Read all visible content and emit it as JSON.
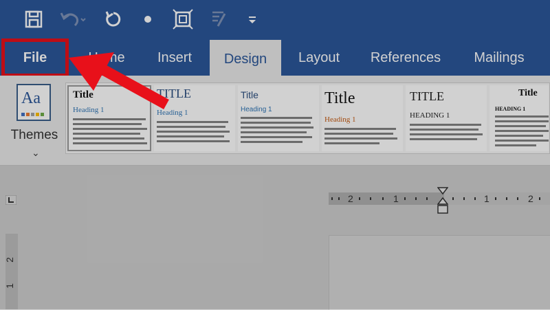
{
  "colors": {
    "ribbon_blue": "#2b579a",
    "annotation_red": "#e8101a",
    "heading_blue": "#2e74b5",
    "heading_orange": "#c55a11"
  },
  "quick_access": {
    "items": [
      {
        "name": "save-icon"
      },
      {
        "name": "undo-icon"
      },
      {
        "name": "repeat-icon"
      },
      {
        "name": "dot-icon"
      },
      {
        "name": "select-icon"
      },
      {
        "name": "format-painter-icon"
      },
      {
        "name": "customize-icon"
      }
    ]
  },
  "tabs": {
    "file": "File",
    "home": "Home",
    "insert": "Insert",
    "design": "Design",
    "layout": "Layout",
    "references": "References",
    "mailings": "Mailings"
  },
  "ribbon": {
    "themes_label": "Themes",
    "themes_caret": "⌄",
    "themes_icon_text": "Aa",
    "styles": [
      {
        "title": "Title",
        "heading": "Heading 1"
      },
      {
        "title": "TITLE",
        "heading": "Heading 1"
      },
      {
        "title": "Title",
        "heading": "Heading 1"
      },
      {
        "title": "Title",
        "heading": "Heading 1"
      },
      {
        "title": "TITLE",
        "heading": "HEADING 1"
      },
      {
        "title": "Title",
        "heading": "HEADING 1"
      }
    ]
  },
  "ruler": {
    "corner": "L",
    "h_numbers": [
      "2",
      "1",
      "1",
      "2"
    ],
    "v_numbers": [
      "2",
      "1"
    ]
  }
}
